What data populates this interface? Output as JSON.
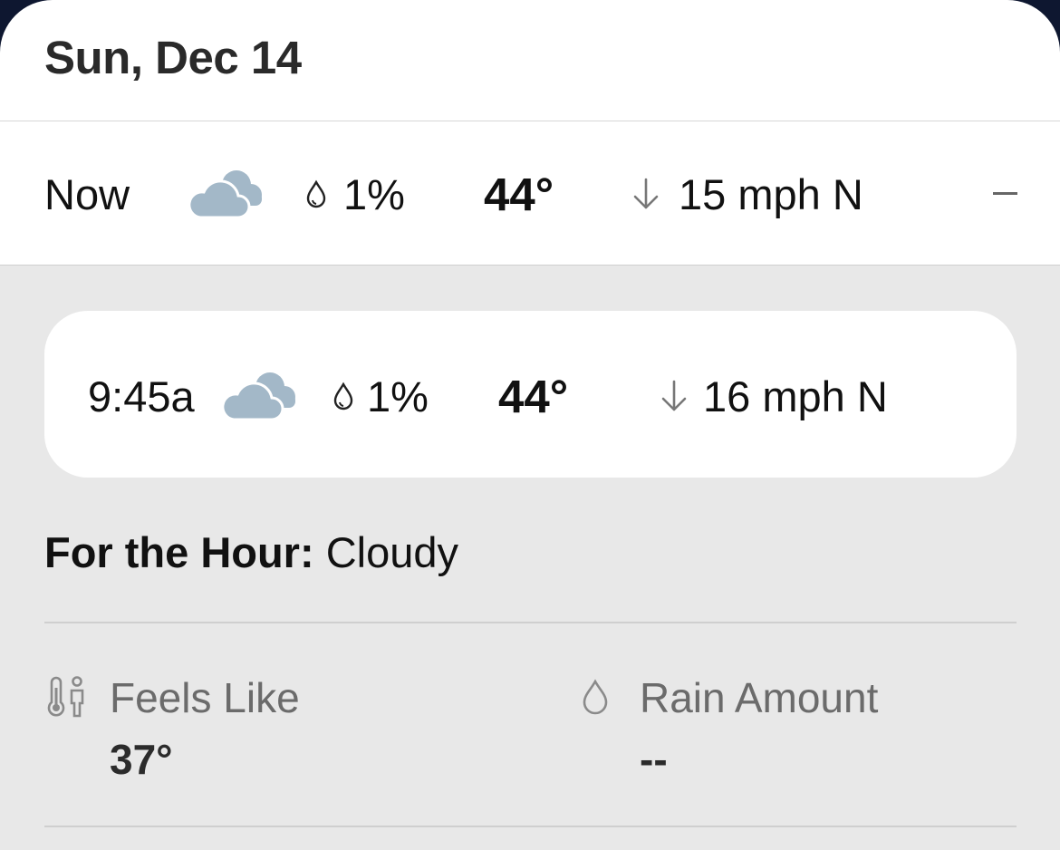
{
  "header": {
    "date": "Sun, Dec 14"
  },
  "now_row": {
    "label": "Now",
    "condition_icon": "cloudy-icon",
    "precip": "1%",
    "temp": "44°",
    "wind": "15 mph N",
    "collapse_icon": "minus-icon"
  },
  "hour_card": {
    "time": "9:45a",
    "condition_icon": "cloudy-icon",
    "precip": "1%",
    "temp": "44°",
    "wind": "16 mph N"
  },
  "summary": {
    "label": "For the Hour:",
    "value": "Cloudy"
  },
  "stats": {
    "feels_like": {
      "label": "Feels Like",
      "value": "37°",
      "icon": "thermometer-person-icon"
    },
    "rain_amount": {
      "label": "Rain Amount",
      "value": "--",
      "icon": "raindrop-icon"
    }
  },
  "colors": {
    "cloud": "#a3b8c8",
    "background_gray": "#e8e8e8",
    "window_edge": "#0e1730"
  }
}
